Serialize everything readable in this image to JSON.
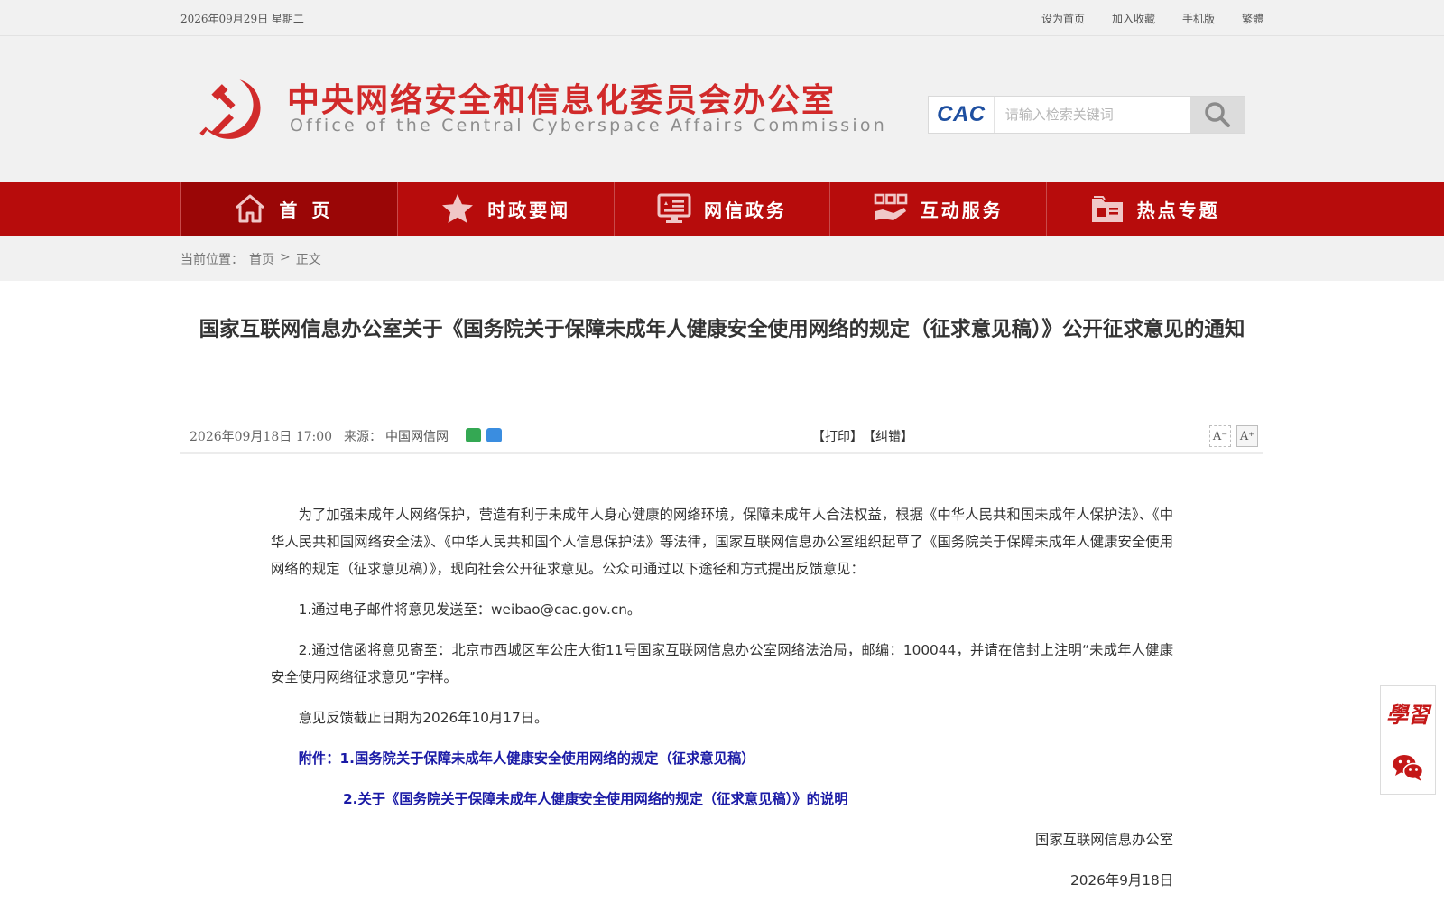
{
  "topbar": {
    "date": "2026年09月29日 星期二",
    "links": [
      "设为首页",
      "加入收藏",
      "手机版",
      "繁體"
    ]
  },
  "header": {
    "title_cn": "中央网络安全和信息化委员会办公室",
    "title_en": "Office of the Central Cyberspace Affairs Commission",
    "emblem_icon": "party-emblem-icon",
    "brand_color": "#d12a2a"
  },
  "search": {
    "logo_text": "CAC",
    "placeholder": "请输入检索关键词",
    "value": ""
  },
  "nav": {
    "color": "#b70c0c",
    "items": [
      {
        "label": "首页",
        "icon": "home-icon"
      },
      {
        "label": "时政要闻",
        "icon": "star-icon"
      },
      {
        "label": "网信政务",
        "icon": "monitor-icon"
      },
      {
        "label": "互动服务",
        "icon": "interact-icon"
      },
      {
        "label": "热点专题",
        "icon": "folder-icon"
      }
    ]
  },
  "breadcrumb": {
    "prefix": "当前位置：",
    "home": "首页",
    "sep": ">",
    "current": "正文"
  },
  "article": {
    "title": "国家互联网信息办公室关于《国务院关于保障未成年人健康安全使用网络的规定（征求意见稿）》公开征求意见的通知",
    "time": "2026年09月18日 17:00",
    "source_label": "来源：",
    "source": "中国网信网",
    "print": "【打印】",
    "correct": "【纠错】",
    "font_minus": "A⁻",
    "font_plus": "A⁺",
    "paragraphs": [
      "为了加强未成年人网络保护，营造有利于未成年人身心健康的网络环境，保障未成年人合法权益，根据《中华人民共和国未成年人保护法》、《中华人民共和国网络安全法》、《中华人民共和国个人信息保护法》等法律，国家互联网信息办公室组织起草了《国务院关于保障未成年人健康安全使用网络的规定（征求意见稿）》，现向社会公开征求意见。公众可通过以下途径和方式提出反馈意见：",
      "1.通过电子邮件将意见发送至：weibao@cac.gov.cn。",
      "2.通过信函将意见寄至：北京市西城区车公庄大街11号国家互联网信息办公室网络法治局，邮编：100044，并请在信封上注明“未成年人健康安全使用网络征求意见”字样。",
      "意见反馈截止日期为2026年10月17日。"
    ],
    "attachment1": "附件：1.国务院关于保障未成年人健康安全使用网络的规定（征求意见稿）",
    "attachment2": "2.关于《国务院关于保障未成年人健康安全使用网络的规定（征求意见稿）》的说明",
    "signature": "国家互联网信息办公室",
    "sign_date": "2026年9月18日",
    "link_color": "#1a1aa6"
  },
  "side": {
    "xuexi_text": "學習",
    "wechat_icon": "wechat-icon"
  }
}
